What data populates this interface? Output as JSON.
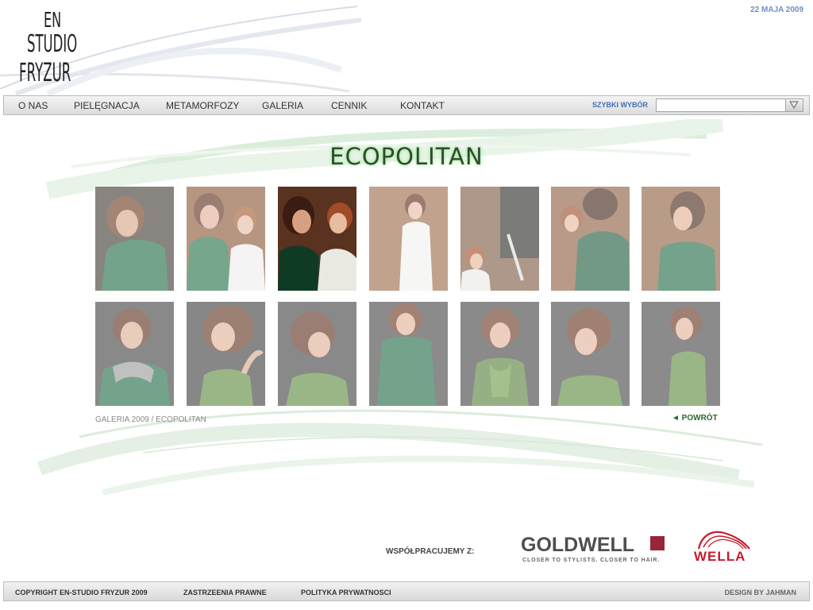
{
  "header": {
    "logo_lines": [
      "EN",
      "STUDIO",
      "FRYZUR"
    ],
    "date": "22 MAJA 2009"
  },
  "nav": {
    "items": [
      {
        "label": "O NAS"
      },
      {
        "label": "PIELĘGNACJA"
      },
      {
        "label": "METAMORFOZY"
      },
      {
        "label": "GALERIA"
      },
      {
        "label": "CENNIK"
      },
      {
        "label": "KONTAKT"
      }
    ],
    "quick_select_label": "SZYBKI WYBÓR",
    "quick_select_value": ""
  },
  "gallery": {
    "title": "ECOPOLITAN",
    "thumb_count": 14,
    "breadcrumb": "GALERIA 2009 / ECOPOLITAN",
    "back_label": "◄ POWRÓT"
  },
  "partners": {
    "label": "WSPÓŁPRACUJEMY Z:",
    "goldwell": "GOLDWELL",
    "goldwell_tagline": "CLOSER TO STYLISTS. CLOSER TO HAIR.",
    "wella": "WELLA"
  },
  "footer": {
    "copyright": "COPYRIGHT EN-STUDIO FRYZUR 2009",
    "legal": "ZASTRZEENIA PRAWNE",
    "privacy": "POLITYKA PRYWATNOSCI",
    "design": "DESIGN BY JAHMAN"
  },
  "colors": {
    "accent_blue": "#3e6fb8",
    "date_blue": "#6f8fc4",
    "green_text": "#2d6a2d",
    "goldwell_red": "#9a2438",
    "wella_red": "#c81a2b"
  }
}
